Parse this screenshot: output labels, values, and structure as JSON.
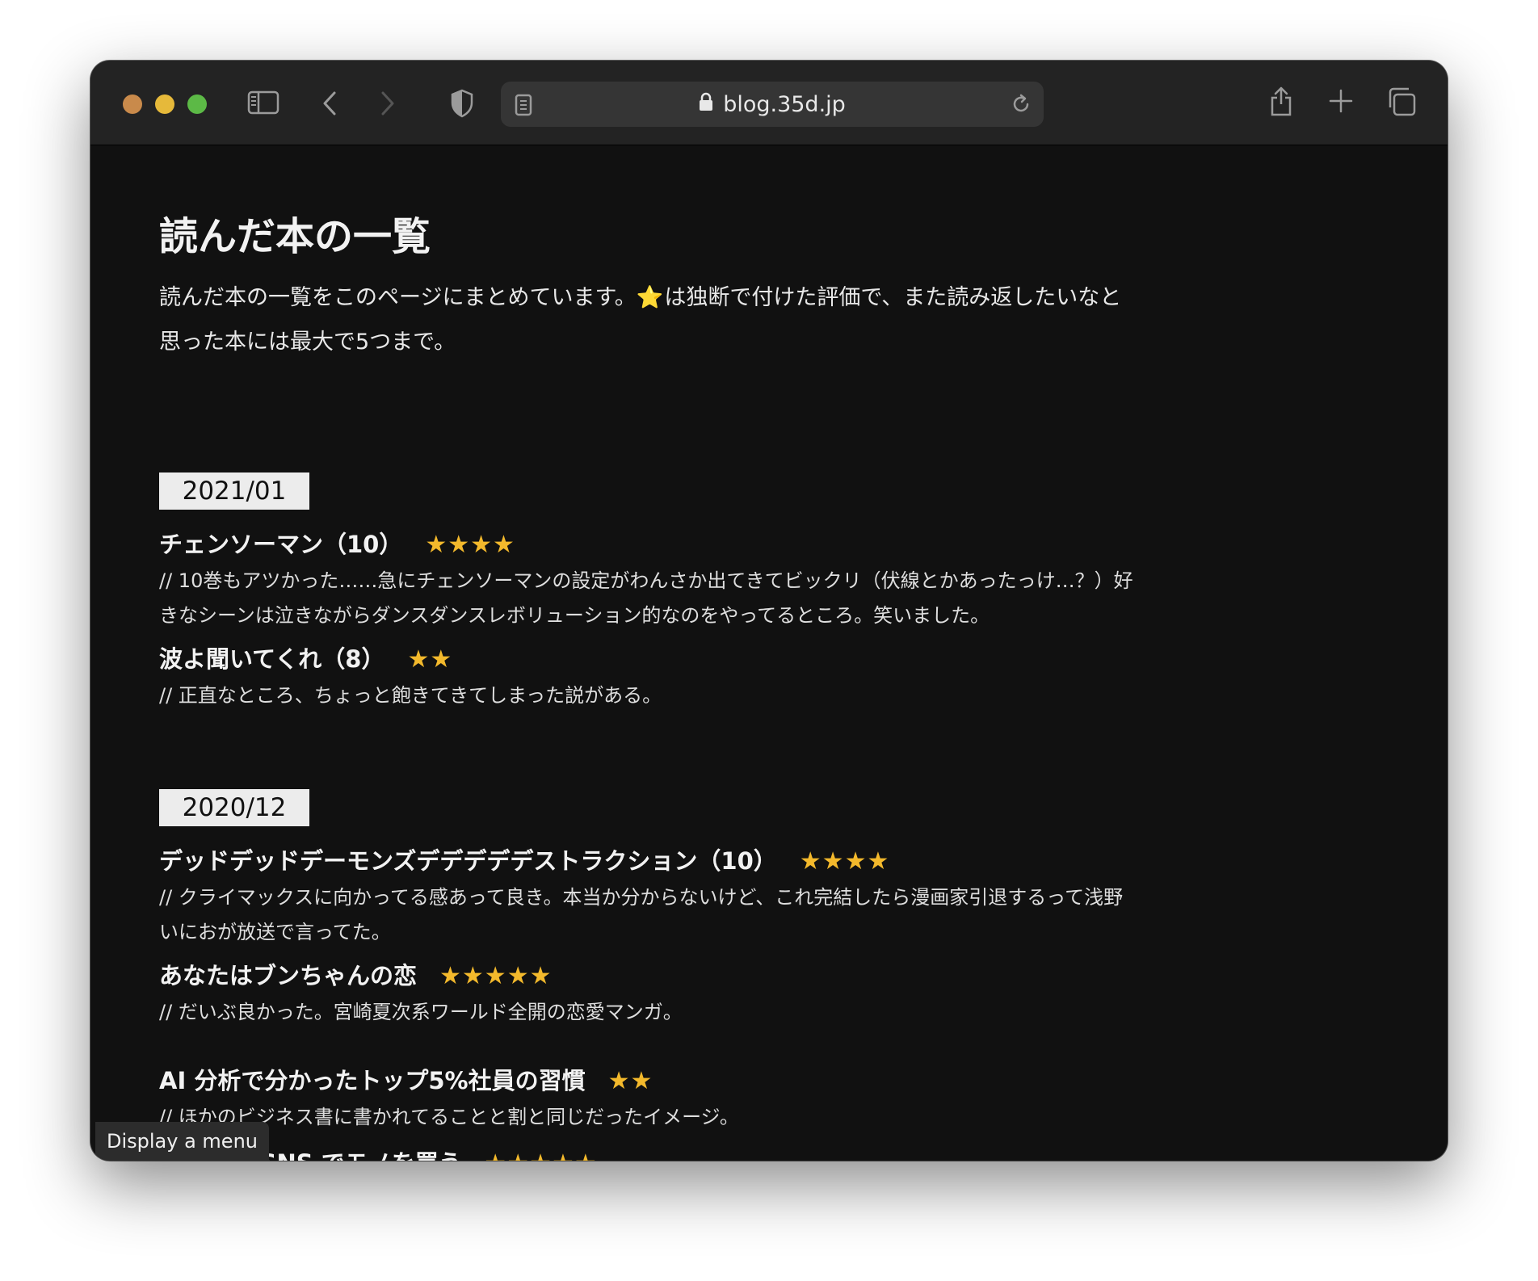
{
  "browser": {
    "url": "blog.35d.jp",
    "icons": [
      "close-dot",
      "minimize-dot",
      "maximize-dot",
      "sidebar-icon",
      "back-icon",
      "forward-icon",
      "shield-icon",
      "reader-icon",
      "lock-icon",
      "reload-icon",
      "share-icon",
      "plus-icon",
      "tabs-icon"
    ]
  },
  "page": {
    "title": "読んだ本の一覧",
    "intro_part1": "読んだ本の一覧をこのページにまとめています。",
    "intro_star": "⭐",
    "intro_part2": "は独断で付けた評価で、また読み返したいなと思った本には最大で5つまで。"
  },
  "sections": [
    {
      "month": "2021/01",
      "books": [
        {
          "title": "チェンソーマン（10）",
          "rating": 4,
          "stars": "★★★★",
          "note": "// 10巻もアツかった……急にチェンソーマンの設定がわんさか出てきてビックリ（伏線とかあったっけ…？）好きなシーンは泣きながらダンスダンスレボリューション的なのをやってるところ。笑いました。"
        },
        {
          "title": "波よ聞いてくれ（8）",
          "rating": 2,
          "stars": "★★",
          "note": "// 正直なところ、ちょっと飽きてきてしまった説がある。"
        }
      ]
    },
    {
      "month": "2020/12",
      "books": [
        {
          "title": "デッドデッドデーモンズデデデデデストラクション（10）",
          "rating": 4,
          "stars": "★★★★",
          "note": "// クライマックスに向かってる感あって良き。本当か分からないけど、これ完結したら漫画家引退するって浅野いにおが放送で言ってた。"
        },
        {
          "title": "あなたはブンちゃんの恋",
          "rating": 5,
          "stars": "★★★★★",
          "note": "// だいぶ良かった。宮崎夏次系ワールド全開の恋愛マンガ。"
        },
        {
          "title": "AI 分析で分かったトップ5%社員の習慣",
          "rating": 2,
          "stars": "★★",
          "note": "// ほかのビジネス書に書かれてることと割と同じだったイメージ。"
        },
        {
          "title": "誘われる SNS でモノを買う",
          "rating": 5,
          "stars": "★★★★★",
          "note": ""
        }
      ]
    }
  ],
  "tooltip": "Display a menu",
  "colors": {
    "star": "#f3b92c",
    "page_bg": "#111111",
    "toolbar_bg": "#232323",
    "month_badge_bg": "#ececec"
  }
}
